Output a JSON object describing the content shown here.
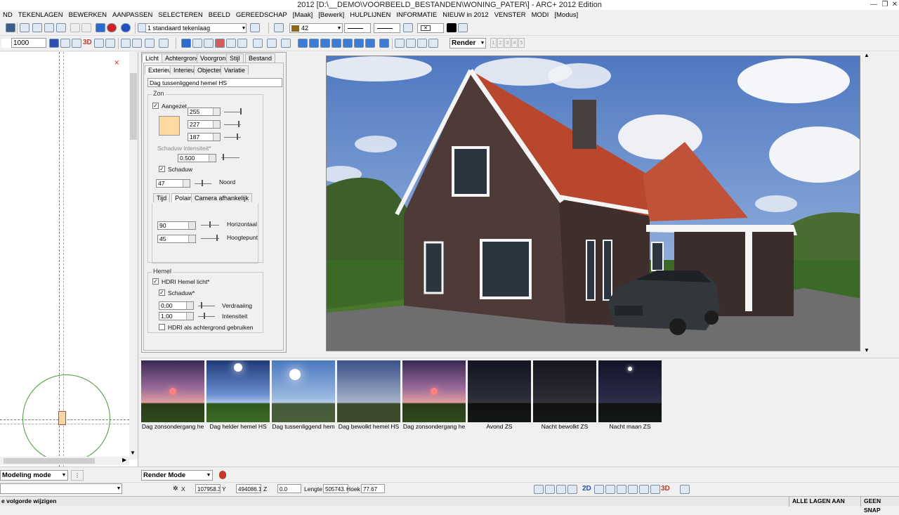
{
  "window": {
    "title": "2012 [D:\\__DEMO\\VOORBEELD_BESTANDEN\\WONING_PATER\\] - ARC+ 2012 Edition"
  },
  "menu": [
    "ND",
    "TEKENLAGEN",
    "BEWERKEN",
    "AANPASSEN",
    "SELECTEREN",
    "BEELD",
    "GEREEDSCHAP",
    "[Maak]",
    "[Bewerk]",
    "HULPLIJNEN",
    "INFORMATIE",
    "NIEUW in 2012",
    "VENSTER",
    "MODI",
    "[Modus]"
  ],
  "toolbar1": {
    "layer_value": "1 standaard tekenlaag",
    "color_value": "42"
  },
  "toolbar2": {
    "scale_value": "1000",
    "render_select": "Render",
    "view_3d": "3D",
    "small_boxes": [
      "1",
      "2",
      "3",
      "4",
      "5"
    ]
  },
  "colors": {
    "swatch": "#fdd8a2",
    "accent": "#c0392b",
    "roof": "#b9472e"
  },
  "panel": {
    "tabs_top": [
      "Licht",
      "Achtergrond",
      "Voorgrond",
      "Stijl",
      "Bestand"
    ],
    "tabs_sub": [
      "Exterieur",
      "Interieur",
      "Objecten",
      "Variatie"
    ],
    "preset_value": "Dag tussenliggend hemel HS",
    "zon": {
      "label": "Zon",
      "aangezet_label": "Aangezet",
      "r": "255",
      "g": "227",
      "b": "187",
      "shadow_intensity_label": "Schaduw intensiteit*",
      "shadow_intensity": "0,500",
      "schaduw_label": "Schaduw",
      "noord_value": "47",
      "noord_label": "Noord",
      "subtabs": [
        "Tijd",
        "Polair",
        "Camera afhankelijk"
      ],
      "horizontaal_value": "90",
      "horizontaal_label": "Horizontaal",
      "hoogtepunt_value": "45",
      "hoogtepunt_label": "Hoogtepunt"
    },
    "hemel": {
      "label": "Hemel",
      "hdri_label": "HDRI Hemel licht*",
      "schaduw_label": "Schaduw*",
      "verdraaiing_value": "0,00",
      "verdraaiing_label": "Verdraaiing",
      "intensiteit_value": "1,00",
      "intensiteit_label": "Intensiteit",
      "achtergrond_label": "HDRI als achtergrond gebruiken"
    }
  },
  "thumbnails": [
    {
      "caption": "Dag  zonsondergang he",
      "kind": "sunset"
    },
    {
      "caption": "Dag helder hemel HS",
      "kind": "clear"
    },
    {
      "caption": "Dag  tussenliggend hem",
      "kind": "mid"
    },
    {
      "caption": "Dag bewolkt hemel HS",
      "kind": "cloudy"
    },
    {
      "caption": "Dag  zonsondergang he",
      "kind": "sunset"
    },
    {
      "caption": "Avond ZS",
      "kind": "evening"
    },
    {
      "caption": "Nacht bewolkt ZS",
      "kind": "night"
    },
    {
      "caption": "Nacht maan ZS",
      "kind": "moon"
    }
  ],
  "modes": {
    "modeling": "Modeling mode",
    "render": "Render Mode"
  },
  "coords": {
    "x_label": "X",
    "x": "107958.3",
    "y_label": "Y",
    "y": "494086.1",
    "z_label": "Z",
    "z": "0.0",
    "lengte_label": "Lengte",
    "lengte": "505743.",
    "hoek_label": "Hoek",
    "hoek": "77.67",
    "view_2d": "2D",
    "view_3d": "3D"
  },
  "status": {
    "left": "e volgorde wijzigen",
    "lagen": "ALLE LAGEN AAN",
    "snap": "GEEN SNAP"
  }
}
